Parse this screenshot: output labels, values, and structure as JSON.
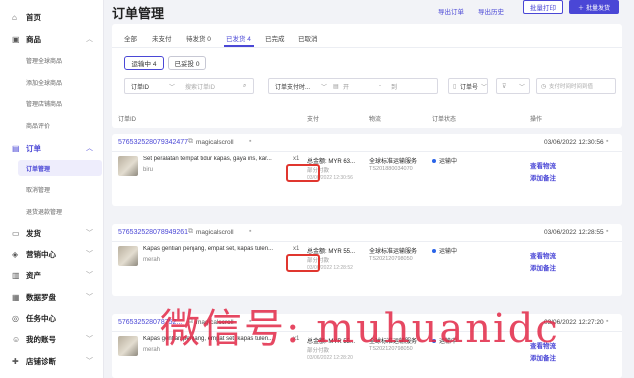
{
  "sidebar": {
    "home": {
      "icon": "home-icon",
      "label": "首页"
    },
    "products": {
      "icon": "bag-icon",
      "label": "商品",
      "subitems": [
        "管理全球商品",
        "添加全球商品",
        "管理店铺商品",
        "商品评价"
      ]
    },
    "orders": {
      "icon": "clipboard-icon",
      "label": "订单",
      "subitems": [
        "订单管理",
        "取消管理",
        "退货退款管理"
      ]
    },
    "more": [
      {
        "icon": "truck-icon",
        "label": "发货"
      },
      {
        "icon": "megaphone-icon",
        "label": "营销中心"
      },
      {
        "icon": "wallet-icon",
        "label": "资产"
      },
      {
        "icon": "chart-icon",
        "label": "数据罗盘"
      },
      {
        "icon": "tasks-icon",
        "label": "任务中心"
      },
      {
        "icon": "user-icon",
        "label": "我的账号"
      },
      {
        "icon": "stethoscope-icon",
        "label": "店铺诊断"
      }
    ]
  },
  "header": {
    "title": "订单管理",
    "export": "导出订单",
    "export_history": "导出历史",
    "batch_print": "批量打印",
    "batch_ship": "批量发货"
  },
  "tabs": [
    "全部",
    "未支付",
    "待发货 0",
    "已发货 4",
    "已完成",
    "已取消"
  ],
  "sub_pills": [
    "运输中 4",
    "已妥投 0"
  ],
  "filters": {
    "order_field": "订单ID",
    "search_placeholder": "搜索订单ID",
    "date_field": "订单支付时...",
    "date_start": "开",
    "date_separator": "-",
    "date_end": "到",
    "status_field": "订单号",
    "more_field": "全部",
    "payment_time_placeholder": "支付时间时间到值"
  },
  "table_headers": [
    "订单ID",
    "支付",
    "物流",
    "订单状态",
    "操作"
  ],
  "orders": [
    {
      "order_id": "576532528079342477",
      "shop": "magicalscroll",
      "date": "03/06/2022 12:30:56",
      "product_title": "Set peralatan tempat tidur kapas, gaya ins, kar...",
      "qty": "x1",
      "seller": "biru",
      "total": "总金额: MYR 63...",
      "pay_status": "部分付款",
      "pay_time": "03/06/2022 12:30:56",
      "logistics": "全球标准运输服务",
      "tracking": "TS201880034070",
      "status": "运输中",
      "actions": [
        "查看物流",
        "添加备注"
      ]
    },
    {
      "order_id": "576532528078949261",
      "shop": "magicalscroll",
      "date": "03/06/2022 12:28:55",
      "product_title": "Kapas gentian penjang, empat set, kapas tulen...",
      "qty": "x1",
      "seller": "merah",
      "total": "总金额: MYR 55...",
      "pay_status": "部分付款",
      "pay_time": "03/06/2022 12:28:52",
      "logistics": "全球标准运输服务",
      "tracking": "TS202120798050",
      "status": "运输中",
      "actions": [
        "查看物流",
        "添加备注"
      ]
    },
    {
      "order_id": "576532528078752...",
      "shop": "magicalscroll",
      "date": "03/06/2022 12:27:20",
      "product_title": "Kapas gentian penjang, empat set, kapas tulen...",
      "qty": "x1",
      "seller": "merah",
      "total": "总金额: MYR 55...",
      "pay_status": "部分付款",
      "pay_time": "03/06/2022 12:28:20",
      "logistics": "全球标准运输服务",
      "tracking": "TS202120798050",
      "status": "运输中",
      "actions": [
        "查看物流",
        "添加备注"
      ]
    }
  ],
  "watermark": "微信号: muhuanidc",
  "colors": {
    "accent": "#4a47d6",
    "highlight": "#e0362f",
    "watermark": "#e22846"
  }
}
